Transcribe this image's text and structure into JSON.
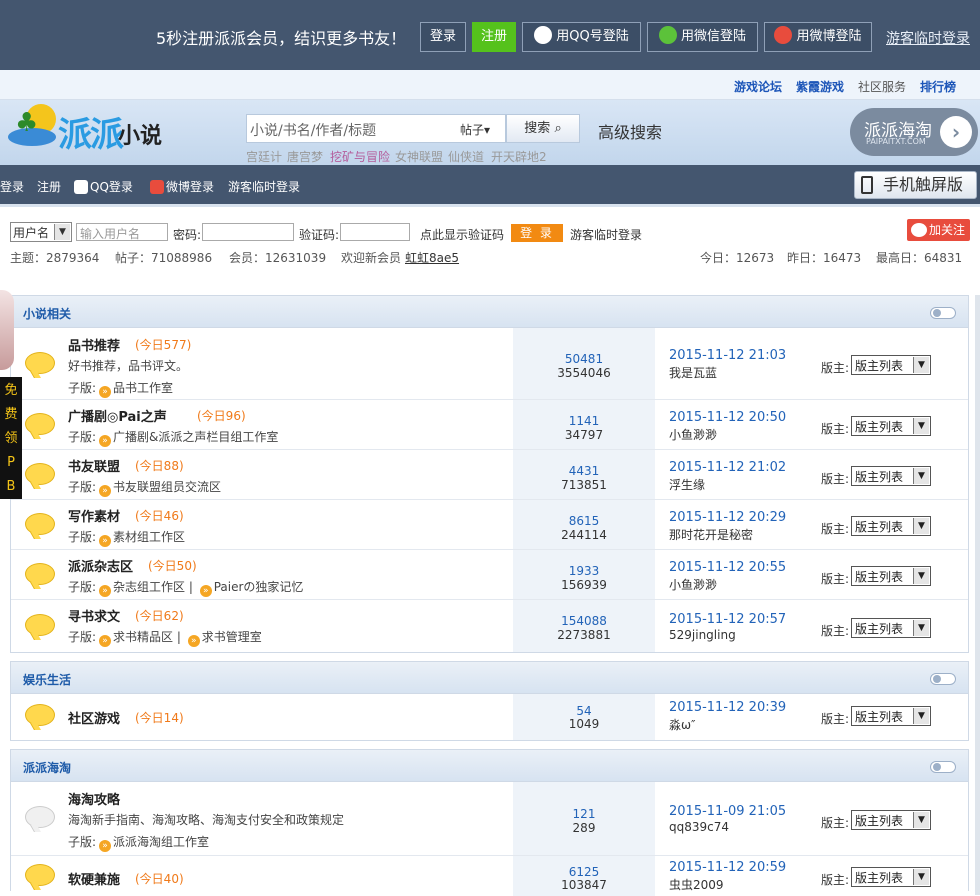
{
  "topbar": {
    "promo": "5秒注册派派会员，结识更多书友！",
    "login": "登录",
    "register": "注册",
    "qq_login": "用QQ号登陆",
    "wechat_login": "用微信登陆",
    "weibo_login": "用微博登陆",
    "guest_login": "游客临时登录"
  },
  "subnav": [
    "游戏论坛",
    "紫霞游戏",
    "社区服务",
    "排行榜"
  ],
  "header": {
    "logo_main": "派派",
    "logo_sub": "小说",
    "search_placeholder": "小说/书名/作者/标题",
    "search_category": "帖子▾",
    "search_button": "搜索",
    "advanced_search": "高级搜索",
    "hot_links": [
      "宫廷计",
      "唐宫梦",
      "挖矿与冒险",
      "女神联盟",
      "仙侠道",
      "开天辟地2"
    ],
    "paipai_title": "派派海淘",
    "paipai_url": "PAIPAITXT.COM"
  },
  "toolbar": {
    "items": [
      "登录",
      "注册",
      "QQ登录",
      "微博登录",
      "游客临时登录"
    ],
    "mobile": "手机触屏版"
  },
  "login_form": {
    "select_value": "用户名",
    "username_placeholder": "输入用户名",
    "password_label": "密码:",
    "captcha_label": "验证码:",
    "captcha_hint": "点此显示验证码",
    "login_button": "登 录",
    "guest": "游客临时登录",
    "follow": "加关注"
  },
  "stats": {
    "topics": "主题：2879364",
    "posts": "帖子：71088986",
    "members": "会员：12631039",
    "welcome": "欢迎新会员",
    "new_member": "虹虹8ae5",
    "today": "今日：12673",
    "yesterday": "昨日：16473",
    "max": "最高日：64831"
  },
  "side_ad": [
    "免",
    "费",
    "领",
    "P",
    "B"
  ],
  "mod_label": "版主:",
  "mod_select": "版主列表",
  "sub_label": "子版:",
  "categories": [
    {
      "title": "小说相关",
      "forums": [
        {
          "name": "品书推荐",
          "today": "(今日577)",
          "desc": "好书推荐，品书评文。",
          "subs": [
            "品书工作室"
          ],
          "posts": "50481",
          "total": "3554046",
          "time": "2015-11-12 21:03",
          "user": "我是瓦蓝"
        },
        {
          "name": "广播剧◎Pai之声",
          "today": "(今日96)",
          "desc": "",
          "subs": [
            "广播剧&派派之声栏目组工作室"
          ],
          "posts": "1141",
          "total": "34797",
          "time": "2015-11-12 20:50",
          "user": "小鱼渺渺"
        },
        {
          "name": "书友联盟",
          "today": "(今日88)",
          "desc": "",
          "subs": [
            "书友联盟组员交流区"
          ],
          "posts": "4431",
          "total": "713851",
          "time": "2015-11-12 21:02",
          "user": "浮生缘"
        },
        {
          "name": "写作素材",
          "today": "(今日46)",
          "desc": "",
          "subs": [
            "素材组工作区"
          ],
          "posts": "8615",
          "total": "244114",
          "time": "2015-11-12 20:29",
          "user": "那时花开是秘密"
        },
        {
          "name": "派派杂志区",
          "today": "(今日50)",
          "desc": "",
          "subs": [
            "杂志组工作区",
            "Paierの独家记忆"
          ],
          "posts": "1933",
          "total": "156939",
          "time": "2015-11-12 20:55",
          "user": "小鱼渺渺"
        },
        {
          "name": "寻书求文",
          "today": "(今日62)",
          "desc": "",
          "subs": [
            "求书精品区",
            "求书管理室"
          ],
          "posts": "154088",
          "total": "2273881",
          "time": "2015-11-12 20:57",
          "user": "529jingling"
        }
      ]
    },
    {
      "title": "娱乐生活",
      "forums": [
        {
          "name": "社区游戏",
          "today": "(今日14)",
          "desc": "",
          "subs": [],
          "posts": "54",
          "total": "1049",
          "time": "2015-11-12 20:39",
          "user": "淼ω″"
        }
      ]
    },
    {
      "title": "派派海淘",
      "forums": [
        {
          "name": "海淘攻略",
          "today": "",
          "desc": "海淘新手指南、海淘攻略、海淘支付安全和政策规定",
          "subs": [
            "派派海淘组工作室"
          ],
          "posts": "121",
          "total": "289",
          "time": "2015-11-09 21:05",
          "user": "qq839c74"
        },
        {
          "name": "软硬兼施",
          "today": "(今日40)",
          "desc": "",
          "subs": [],
          "posts": "6125",
          "total": "103847",
          "time": "2015-11-12 20:59",
          "user": "虫虫2009"
        }
      ]
    }
  ]
}
